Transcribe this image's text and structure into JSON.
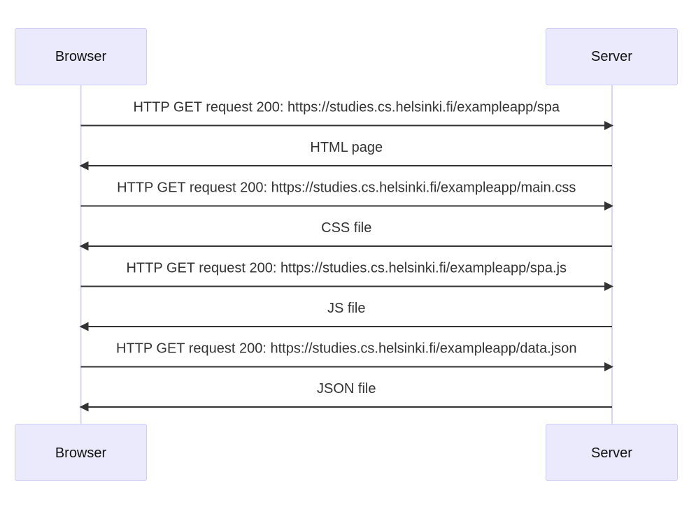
{
  "participants": [
    {
      "id": "browser",
      "label": "Browser"
    },
    {
      "id": "server",
      "label": "Server"
    }
  ],
  "messages": [
    {
      "from": "browser",
      "to": "server",
      "label": "HTTP GET request 200: https://studies.cs.helsinki.fi/exampleapp/spa"
    },
    {
      "from": "server",
      "to": "browser",
      "label": "HTML page"
    },
    {
      "from": "browser",
      "to": "server",
      "label": "HTTP GET request 200: https://studies.cs.helsinki.fi/exampleapp/main.css"
    },
    {
      "from": "server",
      "to": "browser",
      "label": "CSS file"
    },
    {
      "from": "browser",
      "to": "server",
      "label": "HTTP GET request 200: https://studies.cs.helsinki.fi/exampleapp/spa.js"
    },
    {
      "from": "server",
      "to": "browser",
      "label": "JS file"
    },
    {
      "from": "browser",
      "to": "server",
      "label": "HTTP GET request 200: https://studies.cs.helsinki.fi/exampleapp/data.json"
    },
    {
      "from": "server",
      "to": "browser",
      "label": "JSON file"
    }
  ],
  "colors": {
    "actor_fill": "#eaeafc",
    "actor_stroke": "#cdccf5",
    "lifeline": "#d6d5f2",
    "message": "#333333"
  }
}
